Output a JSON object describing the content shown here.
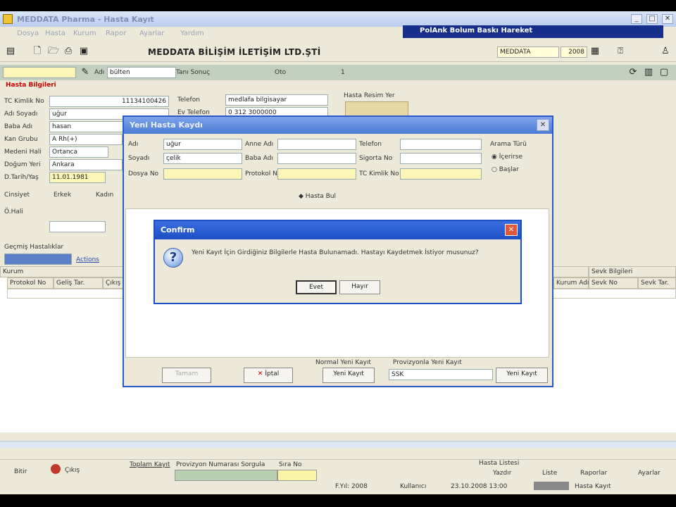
{
  "window": {
    "title": "MEDDATA Pharma - Hasta Kayıt",
    "controls": {
      "minimize": "_",
      "maximize": "□",
      "close": "✕"
    }
  },
  "menu": [
    "Dosya",
    "Hasta",
    "Kurum",
    "Rapor",
    "Ayarlar",
    "Yardım"
  ],
  "header_bar": {
    "text": "PolAnk Bolum Baskı Hareket"
  },
  "toolbar": {
    "company": "MEDDATA BİLİŞİM İLETİŞİM LTD.ŞTİ",
    "company_field": "MEDDATA",
    "year_field": "2008"
  },
  "filter": {
    "label_prefix": "Adı",
    "value": "bülten",
    "label2": "Tanı Sonuç",
    "label3": "Oto",
    "label4": "1"
  },
  "patient": {
    "section_title": "Hasta Bilgileri",
    "fields": [
      {
        "label": "TC Kimlik No",
        "value": "11134100426"
      },
      {
        "label": "Adı Soyadı",
        "value": "uğur"
      },
      {
        "label": "Baba Adı",
        "value": "hasan"
      },
      {
        "label": "Kan Grubu",
        "value": "A Rh(+)"
      },
      {
        "label": "Medeni Hali",
        "value": "Ortanca"
      },
      {
        "label": "Doğum Yeri",
        "value": "Ankara"
      },
      {
        "label": "D.Tarih/Yaş",
        "value": "11.01.1981"
      }
    ],
    "cinsiyet_label": "Cinsiyet",
    "gender_male": "Erkek",
    "gender_female": "Kadın",
    "ozel_label": "Ö.Hali",
    "phone_label": "Telefon",
    "phone_value": "medlafa bilgisayar",
    "mobile_label": "Ev Telefon",
    "mobile_value": "0 312 3000000",
    "photo_label": "Hasta Resim Yer",
    "history_label": "Geçmiş Hastalıklar",
    "actions_label": "Actions"
  },
  "grid": {
    "group1": "Kurum",
    "group2": "Sevk Bilgileri",
    "columns": [
      "Protokol No",
      "Geliş Tar.",
      "Çıkış",
      "Kurum Adı",
      "Sevk No",
      "Sevk Tar."
    ]
  },
  "dialog": {
    "title": "Yeni Hasta Kaydı",
    "fields": {
      "adi_label": "Adı",
      "adi_value": "uğur",
      "soyadi_label": "Soyadı",
      "soyadi_value": "çelik",
      "dosya_label": "Dosya No",
      "anneadi_label": "Anne Adı",
      "babaadi_label": "Baba Adı",
      "protokol_label": "Protokol No",
      "telefon_label": "Telefon",
      "sigorta_label": "Sigorta No",
      "tckimlik_label": "TC Kimlik No",
      "arama_label": "Arama Türü",
      "radio1": "İçerirse",
      "radio2": "Başlar"
    },
    "search_button": "Hasta Bul",
    "tamam_button": "Tamam",
    "iptal_button": "İptal",
    "normal_kayit_label": "Normal Yeni Kayıt",
    "yeni_kayit_button": "Yeni Kayıt",
    "previously_label": "Provizyonla Yeni Kayıt",
    "select_value": "SSK",
    "yeni_kayit2_button": "Yeni Kayıt"
  },
  "alert": {
    "title": "Confirm",
    "message": "Yeni Kayıt İçin Girdiğiniz Bilgilerle Hasta Bulunamadı. Hastayı Kaydetmek İstiyor musunuz?",
    "yes_button": "Evet",
    "no_button": "Hayır"
  },
  "status": {
    "left1": "Bitir",
    "left2": "Çıkış",
    "label_middle": "Toplam Kayıt",
    "prov_label": "Provizyon Numarası Sorgula",
    "sira_label": "Sıra No",
    "reports_title": "Hasta Listesi",
    "r1": "Yazdır",
    "r2": "Liste",
    "r3": "Raporlar",
    "r4": "Ayarlar",
    "foot1": "F.Yıl: 2008",
    "foot2": "Kullanıcı",
    "foot3": "23.10.2008 13:00",
    "foot4": "Hasta Kayıt"
  }
}
